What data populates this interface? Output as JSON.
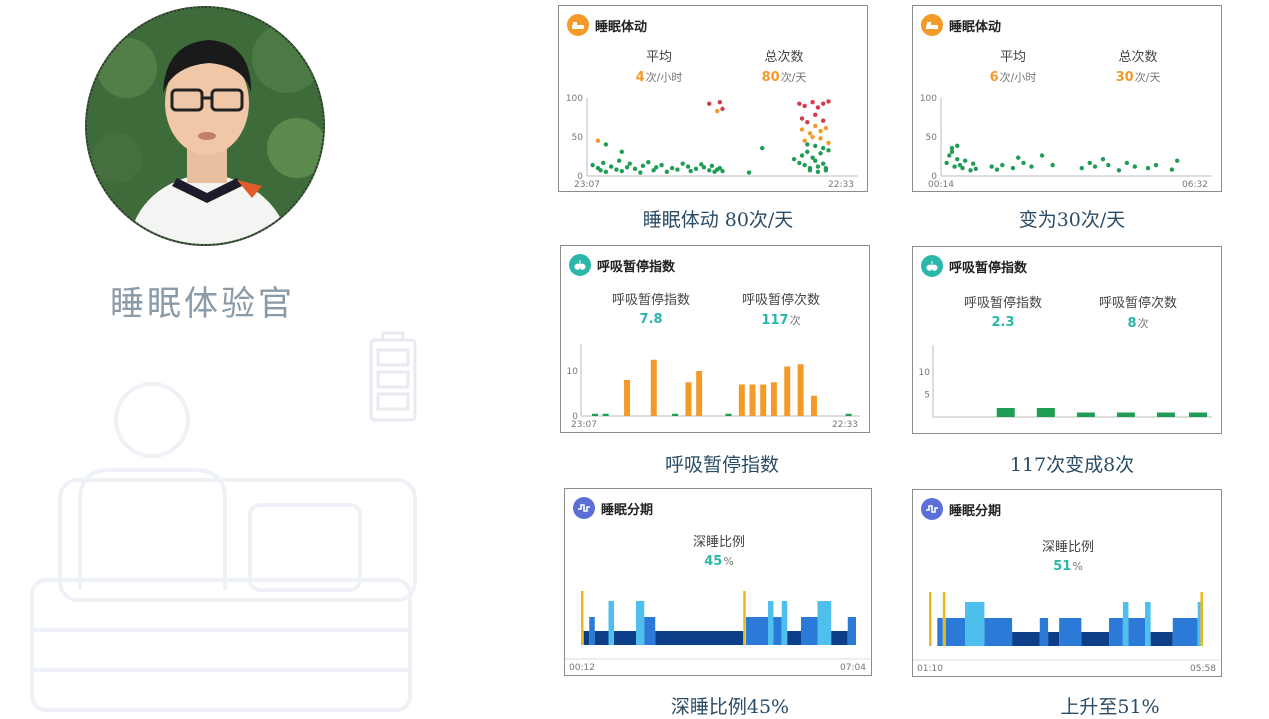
{
  "left": {
    "role_title": "睡眠体验官"
  },
  "colors": {
    "orange": "#f39a2a",
    "teal": "#2ab7a9",
    "green": "#1f9d55",
    "red": "#d83a4a",
    "blue_icon": "#5b6fd6",
    "deep": "#0d3e8a",
    "light": "#2b7ad8",
    "rem": "#4fc0ee",
    "awake": "#e8b818",
    "caption": "#2a4c66"
  },
  "cards": {
    "movement_before": {
      "title": "睡眠体动",
      "stat1_label": "平均",
      "stat1_value": "4",
      "stat1_unit": "次/小时",
      "stat2_label": "总次数",
      "stat2_value": "80",
      "stat2_unit": "次/天",
      "caption": "睡眠体动 80次/天"
    },
    "movement_after": {
      "title": "睡眠体动",
      "stat1_label": "平均",
      "stat1_value": "6",
      "stat1_unit": "次/小时",
      "stat2_label": "总次数",
      "stat2_value": "30",
      "stat2_unit": "次/天",
      "caption": "变为30次/天"
    },
    "apnea_before": {
      "title": "呼吸暂停指数",
      "stat1_label": "呼吸暂停指数",
      "stat1_value": "7.8",
      "stat1_unit": "",
      "stat2_label": "呼吸暂停次数",
      "stat2_value": "117",
      "stat2_unit": "次",
      "caption": "呼吸暂停指数"
    },
    "apnea_after": {
      "title": "呼吸暂停指数",
      "stat1_label": "呼吸暂停指数",
      "stat1_value": "2.3",
      "stat1_unit": "",
      "stat2_label": "呼吸暂停次数",
      "stat2_value": "8",
      "stat2_unit": "次",
      "caption": "117次变成8次"
    },
    "stage_before": {
      "title": "睡眠分期",
      "stat1_label": "深睡比例",
      "stat1_value": "45",
      "stat1_unit": "%",
      "caption": "深睡比例45%"
    },
    "stage_after": {
      "title": "睡眠分期",
      "stat1_label": "深睡比例",
      "stat1_value": "51",
      "stat1_unit": "%",
      "caption": "上升至51%"
    }
  },
  "chart_data": [
    {
      "type": "scatter",
      "id": "movement_before",
      "x_start_label": "23:07",
      "x_end_label": "22:33",
      "ylim": [
        0,
        100
      ],
      "yticks": [
        "100",
        "50",
        "0"
      ],
      "x": [
        0.01,
        0.03,
        0.04,
        0.05,
        0.06,
        0.08,
        0.1,
        0.11,
        0.12,
        0.14,
        0.15,
        0.17,
        0.19,
        0.2,
        0.22,
        0.24,
        0.25,
        0.27,
        0.29,
        0.31,
        0.33,
        0.35,
        0.37,
        0.38,
        0.4,
        0.42,
        0.43,
        0.45,
        0.46,
        0.47,
        0.48,
        0.49,
        0.5,
        0.03,
        0.12,
        0.06,
        0.45,
        0.49,
        0.6,
        0.65,
        0.77,
        0.79,
        0.8,
        0.81,
        0.82,
        0.83,
        0.84,
        0.85,
        0.86,
        0.87,
        0.88,
        0.89,
        0.9,
        0.79,
        0.81,
        0.84,
        0.86,
        0.88,
        0.9,
        0.8,
        0.83,
        0.85,
        0.87,
        0.89,
        0.81,
        0.84,
        0.87,
        0.9,
        0.8,
        0.82,
        0.85,
        0.88,
        0.5,
        0.48,
        0.83,
        0.86,
        0.89,
        0.82,
        0.85,
        0.88
      ],
      "y": [
        12,
        8,
        5,
        15,
        3,
        10,
        6,
        18,
        4,
        9,
        14,
        7,
        2,
        11,
        16,
        5,
        9,
        12,
        3,
        8,
        6,
        14,
        10,
        4,
        7,
        13,
        9,
        5,
        11,
        3,
        6,
        8,
        4,
        45,
        30,
        40,
        95,
        97,
        2,
        35,
        20,
        15,
        25,
        12,
        30,
        8,
        22,
        18,
        10,
        28,
        14,
        5,
        32,
        95,
        92,
        97,
        90,
        95,
        98,
        60,
        55,
        65,
        58,
        62,
        45,
        50,
        48,
        42,
        75,
        70,
        80,
        72,
        88,
        85,
        5,
        3,
        8,
        40,
        38,
        35
      ],
      "colors": [
        "g",
        "g",
        "g",
        "g",
        "g",
        "g",
        "g",
        "g",
        "g",
        "g",
        "g",
        "g",
        "g",
        "g",
        "g",
        "g",
        "g",
        "g",
        "g",
        "g",
        "g",
        "g",
        "g",
        "g",
        "g",
        "g",
        "g",
        "g",
        "g",
        "g",
        "g",
        "g",
        "g",
        "o",
        "g",
        "g",
        "r",
        "r",
        "g",
        "g",
        "g",
        "g",
        "g",
        "g",
        "g",
        "g",
        "g",
        "g",
        "g",
        "g",
        "g",
        "g",
        "g",
        "r",
        "r",
        "r",
        "r",
        "r",
        "r",
        "o",
        "o",
        "o",
        "o",
        "o",
        "o",
        "o",
        "o",
        "o",
        "r",
        "r",
        "r",
        "r",
        "r",
        "o",
        "g",
        "g",
        "g",
        "g",
        "g",
        "g"
      ]
    },
    {
      "type": "scatter",
      "id": "movement_after",
      "x_start_label": "00:14",
      "x_end_label": "06:32",
      "ylim": [
        0,
        100
      ],
      "yticks": [
        "100",
        "50",
        "0"
      ],
      "x": [
        0.01,
        0.02,
        0.03,
        0.04,
        0.05,
        0.06,
        0.07,
        0.08,
        0.1,
        0.11,
        0.12,
        0.18,
        0.2,
        0.22,
        0.26,
        0.28,
        0.3,
        0.33,
        0.37,
        0.41,
        0.52,
        0.55,
        0.57,
        0.6,
        0.62,
        0.66,
        0.69,
        0.72,
        0.77,
        0.8,
        0.86,
        0.88,
        0.03,
        0.05
      ],
      "y": [
        15,
        25,
        30,
        10,
        20,
        12,
        8,
        18,
        5,
        14,
        7,
        10,
        6,
        12,
        8,
        22,
        15,
        10,
        25,
        12,
        8,
        15,
        10,
        20,
        12,
        5,
        15,
        10,
        8,
        12,
        6,
        18,
        35,
        38
      ],
      "colors": [
        "g",
        "g",
        "g",
        "g",
        "g",
        "g",
        "g",
        "g",
        "g",
        "g",
        "g",
        "g",
        "g",
        "g",
        "g",
        "g",
        "g",
        "g",
        "g",
        "g",
        "g",
        "g",
        "g",
        "g",
        "g",
        "g",
        "g",
        "g",
        "g",
        "g",
        "g",
        "g",
        "g",
        "g"
      ]
    },
    {
      "type": "bar",
      "id": "apnea_before",
      "x_start_label": "23:07",
      "x_end_label": "22:33",
      "yticks": [
        "10",
        "0"
      ],
      "ylim": [
        0,
        16
      ],
      "x": [
        0.03,
        0.07,
        0.15,
        0.25,
        0.33,
        0.38,
        0.42,
        0.53,
        0.58,
        0.62,
        0.66,
        0.7,
        0.75,
        0.8,
        0.85,
        0.98
      ],
      "values": [
        0.5,
        0.5,
        8,
        12.5,
        0.5,
        7.5,
        10,
        0.5,
        7,
        7,
        7,
        7.5,
        11,
        11.5,
        4.5,
        0.5
      ],
      "colors": [
        "g",
        "g",
        "o",
        "o",
        "g",
        "o",
        "o",
        "g",
        "o",
        "o",
        "o",
        "o",
        "o",
        "o",
        "o",
        "g"
      ]
    },
    {
      "type": "bar",
      "id": "apnea_after",
      "yticks": [
        "10",
        "5"
      ],
      "ylim": [
        0,
        16
      ],
      "x": [
        0.25,
        0.4,
        0.55,
        0.7,
        0.85,
        0.97
      ],
      "values": [
        2,
        2,
        1,
        1,
        1,
        1
      ],
      "colors": [
        "g",
        "g",
        "g",
        "g",
        "g",
        "g"
      ]
    },
    {
      "type": "area",
      "id": "stage_before",
      "x_start_label": "00:12",
      "x_end_label": "07:04",
      "segments": [
        [
          0.0,
          0.01,
          "awake"
        ],
        [
          0.01,
          0.03,
          "deep"
        ],
        [
          0.03,
          0.05,
          "light"
        ],
        [
          0.05,
          0.1,
          "deep"
        ],
        [
          0.1,
          0.12,
          "rem"
        ],
        [
          0.12,
          0.2,
          "deep"
        ],
        [
          0.2,
          0.23,
          "rem"
        ],
        [
          0.23,
          0.27,
          "light"
        ],
        [
          0.27,
          0.59,
          "deep"
        ],
        [
          0.59,
          0.6,
          "awake"
        ],
        [
          0.6,
          0.68,
          "light"
        ],
        [
          0.68,
          0.7,
          "rem"
        ],
        [
          0.7,
          0.73,
          "light"
        ],
        [
          0.73,
          0.75,
          "rem"
        ],
        [
          0.75,
          0.8,
          "deep"
        ],
        [
          0.8,
          0.86,
          "light"
        ],
        [
          0.86,
          0.91,
          "rem"
        ],
        [
          0.91,
          0.97,
          "deep"
        ],
        [
          0.97,
          1.0,
          "light"
        ]
      ]
    },
    {
      "type": "area",
      "id": "stage_after",
      "x_start_label": "01:10",
      "x_end_label": "05:58",
      "segments": [
        [
          0.0,
          0.03,
          "awake"
        ],
        [
          0.03,
          0.05,
          "light"
        ],
        [
          0.05,
          0.06,
          "awake"
        ],
        [
          0.06,
          0.13,
          "light"
        ],
        [
          0.13,
          0.2,
          "rem"
        ],
        [
          0.2,
          0.3,
          "light"
        ],
        [
          0.3,
          0.4,
          "deep"
        ],
        [
          0.4,
          0.43,
          "light"
        ],
        [
          0.43,
          0.47,
          "deep"
        ],
        [
          0.47,
          0.55,
          "light"
        ],
        [
          0.55,
          0.65,
          "deep"
        ],
        [
          0.65,
          0.7,
          "light"
        ],
        [
          0.7,
          0.72,
          "rem"
        ],
        [
          0.72,
          0.78,
          "light"
        ],
        [
          0.78,
          0.8,
          "rem"
        ],
        [
          0.8,
          0.88,
          "deep"
        ],
        [
          0.88,
          0.97,
          "light"
        ],
        [
          0.97,
          0.98,
          "rem"
        ],
        [
          0.98,
          1.0,
          "awake"
        ]
      ]
    }
  ]
}
